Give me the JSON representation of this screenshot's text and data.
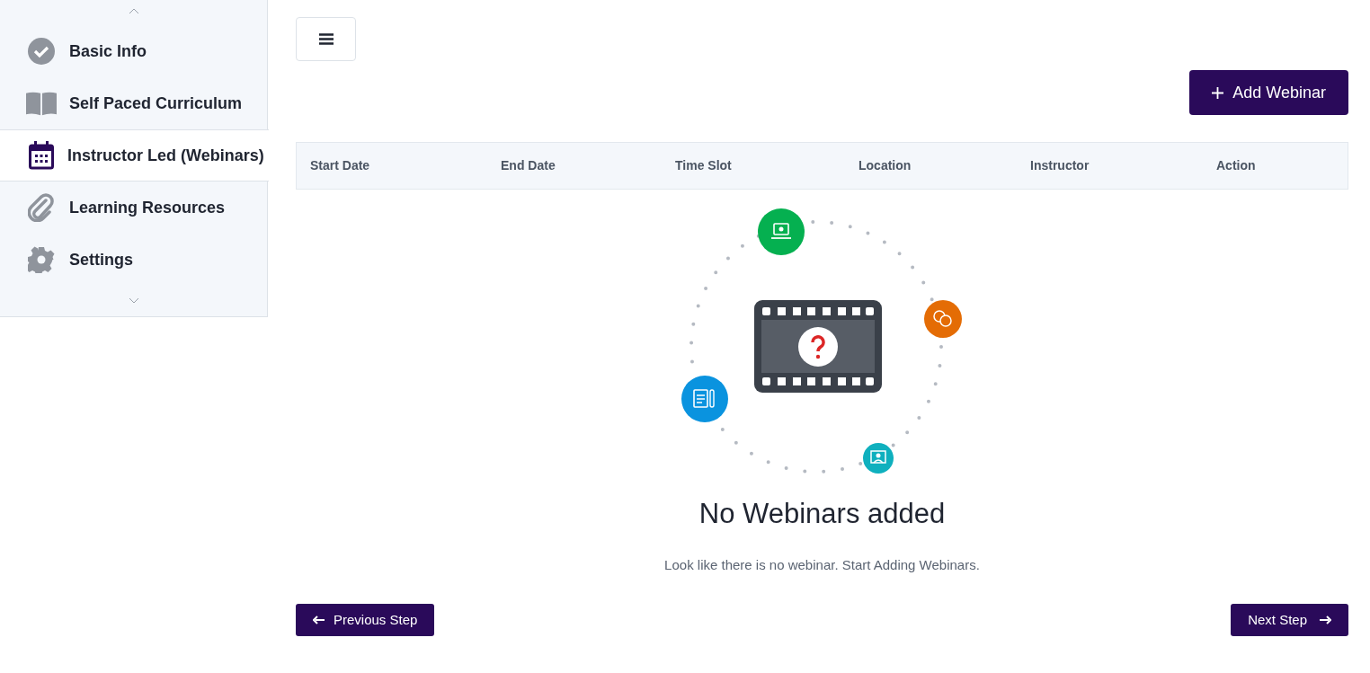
{
  "sidebar": {
    "items": [
      {
        "label": "Basic Info",
        "selected": false
      },
      {
        "label": "Self Paced Curriculum",
        "selected": false
      },
      {
        "label": "Instructor Led (Webinars)",
        "selected": true
      },
      {
        "label": "Learning Resources",
        "selected": false
      },
      {
        "label": "Settings",
        "selected": false
      }
    ]
  },
  "add_button": "Add Webinar",
  "table": {
    "columns": [
      "Start Date",
      "End Date",
      "Time Slot",
      "Location",
      "Instructor",
      "Action"
    ]
  },
  "empty_state": {
    "title": "No Webinars added",
    "message": "Look like there is no webinar. Start Adding Webinars."
  },
  "footer": {
    "previous": "Previous Step",
    "next": "Next Step"
  }
}
